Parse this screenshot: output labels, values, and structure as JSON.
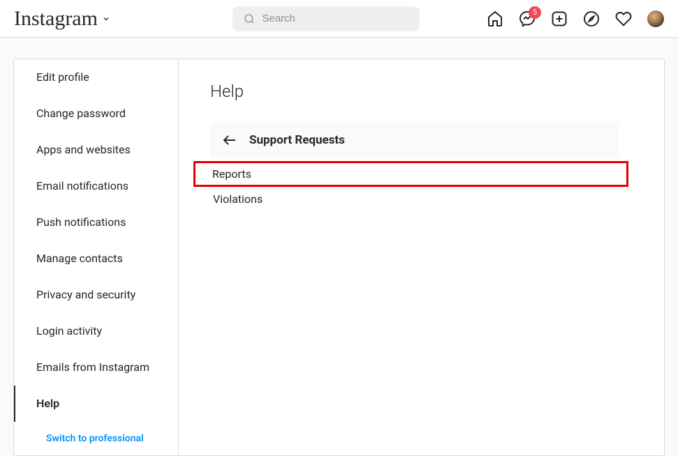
{
  "header": {
    "logo": "Instagram",
    "search_placeholder": "Search",
    "messages_badge": "5"
  },
  "sidebar": {
    "items": [
      {
        "label": "Edit profile"
      },
      {
        "label": "Change password"
      },
      {
        "label": "Apps and websites"
      },
      {
        "label": "Email notifications"
      },
      {
        "label": "Push notifications"
      },
      {
        "label": "Manage contacts"
      },
      {
        "label": "Privacy and security"
      },
      {
        "label": "Login activity"
      },
      {
        "label": "Emails from Instagram"
      },
      {
        "label": "Help"
      }
    ],
    "switch_label": "Switch to professional"
  },
  "main": {
    "title": "Help",
    "section_title": "Support Requests",
    "items": [
      {
        "label": "Reports"
      },
      {
        "label": "Violations"
      }
    ]
  }
}
